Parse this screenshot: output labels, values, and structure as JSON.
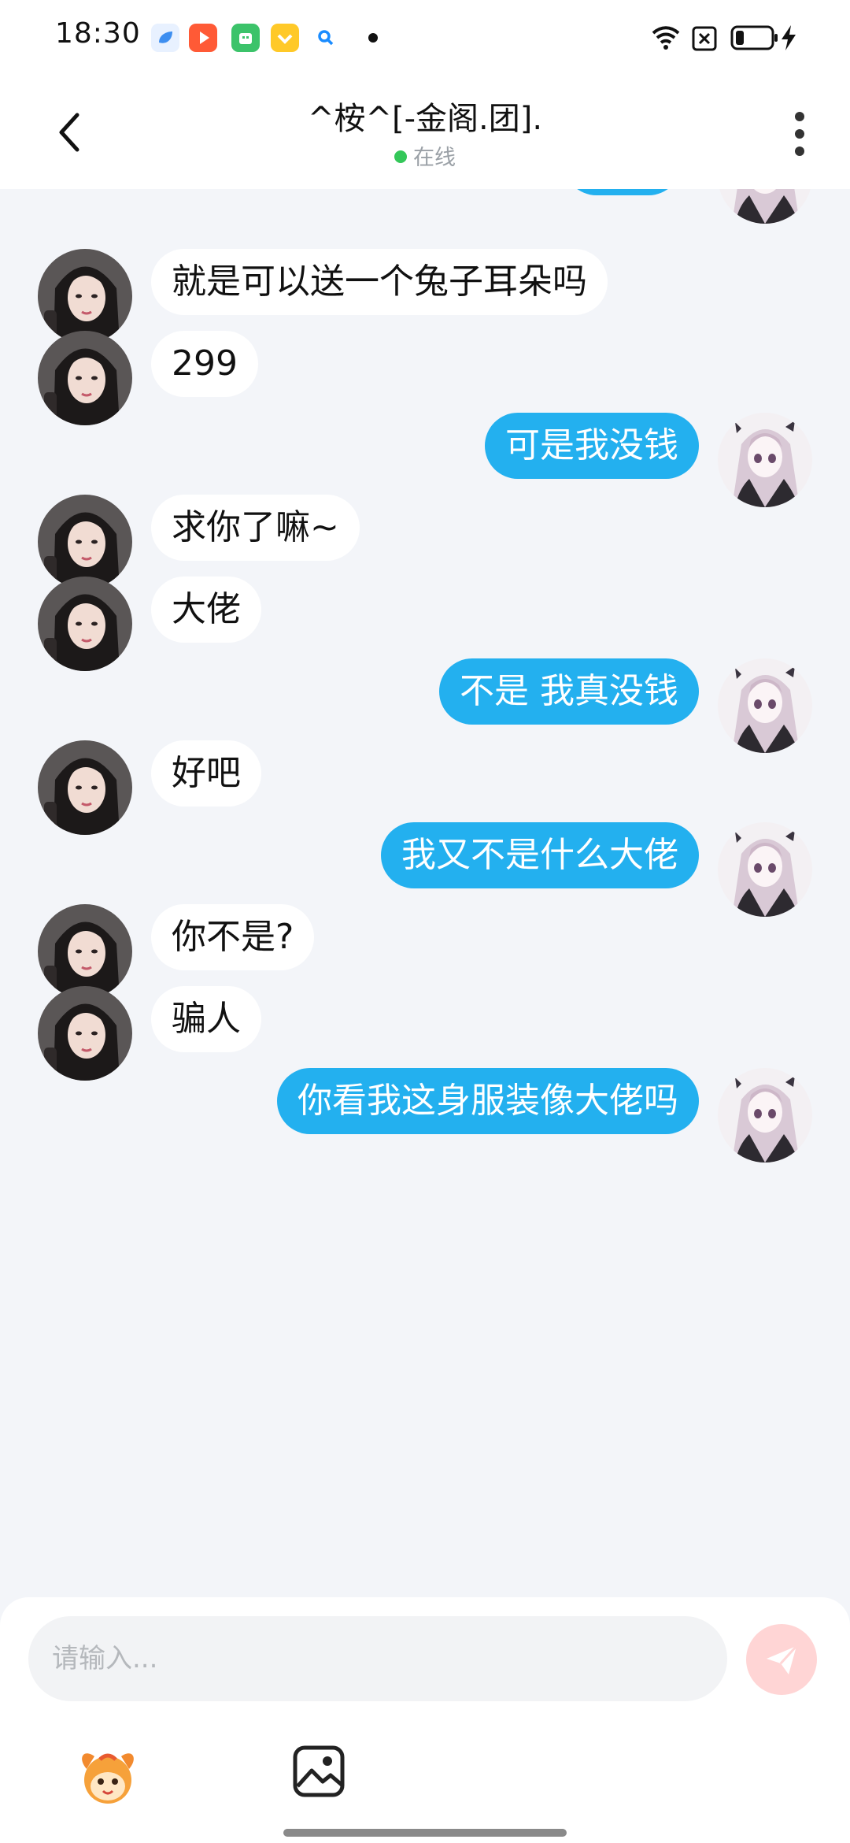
{
  "status_bar": {
    "time": "18:30",
    "notification_apps": [
      "cloud-app-icon",
      "video-app-icon",
      "shopping-app-icon",
      "coupon-app-icon",
      "search-app-icon"
    ],
    "icons": [
      "wifi-icon",
      "sim-off-icon",
      "battery-icon",
      "charging-icon"
    ]
  },
  "header": {
    "title": "^桉^[-金阁.团].",
    "status": "在线",
    "back_icon": "chevron-left-icon",
    "more_icon": "more-vertical-icon"
  },
  "messages": [
    {
      "side": "in",
      "text": "就是可以送一个兔子耳朵吗"
    },
    {
      "side": "in",
      "text": "299"
    },
    {
      "side": "out",
      "text": "可是我没钱"
    },
    {
      "side": "in",
      "text": "求你了嘛~"
    },
    {
      "side": "in",
      "text": "大佬"
    },
    {
      "side": "out",
      "text": "不是 我真没钱"
    },
    {
      "side": "in",
      "text": "好吧"
    },
    {
      "side": "out",
      "text": "我又不是什么大佬"
    },
    {
      "side": "in",
      "text": "你不是?"
    },
    {
      "side": "in",
      "text": "骗人"
    },
    {
      "side": "out",
      "text": "你看我这身服装像大佬吗"
    }
  ],
  "composer": {
    "placeholder": "请输入...",
    "send_icon": "send-icon",
    "tools": [
      "emoji-icon",
      "image-icon"
    ]
  },
  "colors": {
    "accent": "#23b0ef",
    "background": "#f3f5f9",
    "online": "#34c759",
    "send_disabled": "#ffd5d5"
  }
}
